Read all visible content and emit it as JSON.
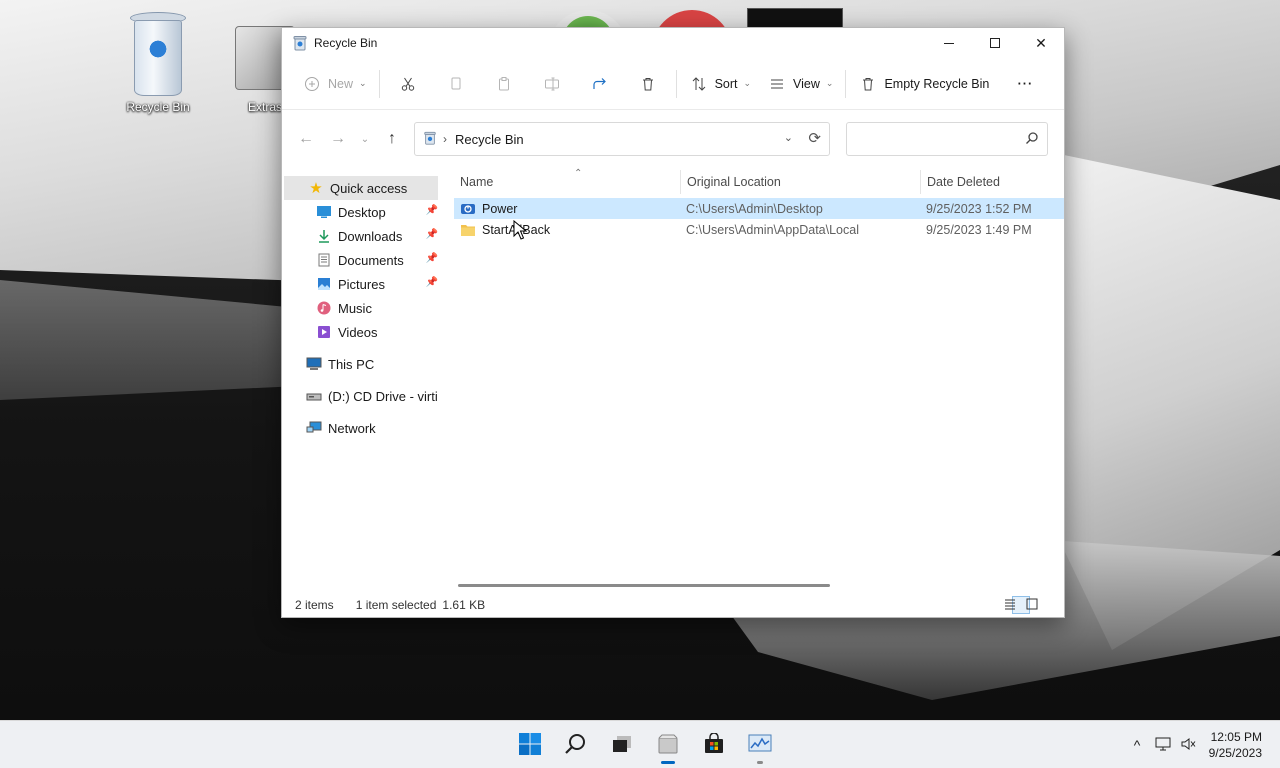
{
  "desktop": {
    "icons": [
      {
        "label": "Recycle Bin"
      },
      {
        "label": "Extras"
      }
    ]
  },
  "window": {
    "title": "Recycle Bin",
    "controls": {
      "minimize": "Minimize",
      "maximize": "Maximize",
      "close": "✕"
    }
  },
  "commandbar": {
    "new_label": "New",
    "sort_label": "Sort",
    "view_label": "View",
    "empty_label": "Empty Recycle Bin",
    "more_label": "···"
  },
  "address": {
    "path": "Recycle Bin",
    "search_placeholder": ""
  },
  "navpane": {
    "quick_access": "Quick access",
    "items": [
      {
        "label": "Desktop",
        "pinned": true
      },
      {
        "label": "Downloads",
        "pinned": true
      },
      {
        "label": "Documents",
        "pinned": true
      },
      {
        "label": "Pictures",
        "pinned": true
      },
      {
        "label": "Music",
        "pinned": false
      },
      {
        "label": "Videos",
        "pinned": false
      }
    ],
    "this_pc": "This PC",
    "cd_drive": "(D:) CD Drive - virti",
    "network": "Network"
  },
  "files": {
    "headers": {
      "name": "Name",
      "location": "Original Location",
      "date": "Date Deleted"
    },
    "rows": [
      {
        "name": "Power",
        "location": "C:\\Users\\Admin\\Desktop",
        "date": "9/25/2023 1:52 PM"
      },
      {
        "name": "StartAllBack",
        "location": "C:\\Users\\Admin\\AppData\\Local",
        "date": "9/25/2023 1:49 PM"
      }
    ]
  },
  "status": {
    "count": "2 items",
    "selected": "1 item selected",
    "size": "1.61 KB"
  },
  "taskbar": {
    "time": "12:05 PM",
    "date": "9/25/2023"
  },
  "colors": {
    "accent": "#0067c0",
    "selection": "#cce8ff",
    "folder": "#f2c14e"
  }
}
